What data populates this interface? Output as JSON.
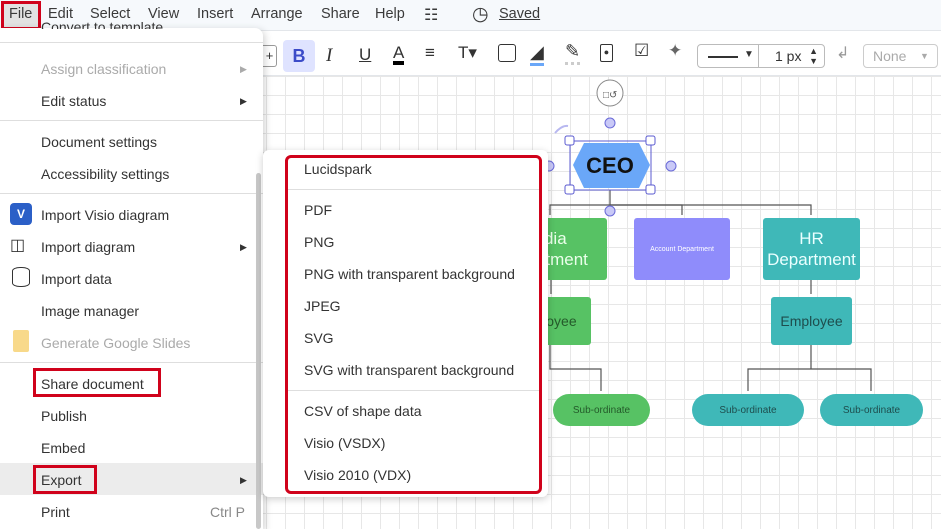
{
  "menubar": {
    "items": [
      "File",
      "Edit",
      "Select",
      "View",
      "Insert",
      "Arrange",
      "Share",
      "Help"
    ],
    "saved": "Saved"
  },
  "toolbar": {
    "line_width": "1 px",
    "arrow_style": "None",
    "colors": {
      "bold_bg": "#dfe3ff",
      "fill_underline": "#6aa7f8"
    }
  },
  "file_menu": {
    "partial_item": "Convert to template",
    "items": [
      {
        "label": "Assign classification",
        "disabled": true,
        "submenu": true
      },
      {
        "label": "Edit status",
        "submenu": true
      },
      {
        "label": "Document settings"
      },
      {
        "label": "Accessibility settings"
      },
      {
        "label": "Import Visio diagram",
        "icon": "visio-icon"
      },
      {
        "label": "Import diagram",
        "icon": "import-diagram-icon",
        "submenu": true
      },
      {
        "label": "Import data",
        "icon": "database-icon"
      },
      {
        "label": "Image manager"
      },
      {
        "label": "Generate Google Slides",
        "icon": "google-slides-icon",
        "disabled": true
      },
      {
        "label": "Share document"
      },
      {
        "label": "Publish"
      },
      {
        "label": "Embed"
      },
      {
        "label": "Export",
        "submenu": true,
        "highlighted": true
      },
      {
        "label": "Print",
        "shortcut": "Ctrl P"
      }
    ]
  },
  "export_menu": {
    "items": [
      "Lucidspark",
      "PDF",
      "PNG",
      "PNG with transparent background",
      "JPEG",
      "SVG",
      "SVG with transparent background",
      "CSV of shape data",
      "Visio (VSDX)",
      "Visio 2010 (VDX)"
    ]
  },
  "diagram": {
    "ceo": "CEO",
    "media_department": "Media Department",
    "account_department": "Account Department",
    "hr_department": "HR Department",
    "employee_media": "Employee",
    "employee_hr": "Employee",
    "subordinate": "Sub-ordinate",
    "colors": {
      "ceo": "#6aa7f8",
      "green": "#57c264",
      "purple": "#8f8cfb",
      "teal": "#3fb8b8",
      "highlight": "#d0021b"
    }
  }
}
